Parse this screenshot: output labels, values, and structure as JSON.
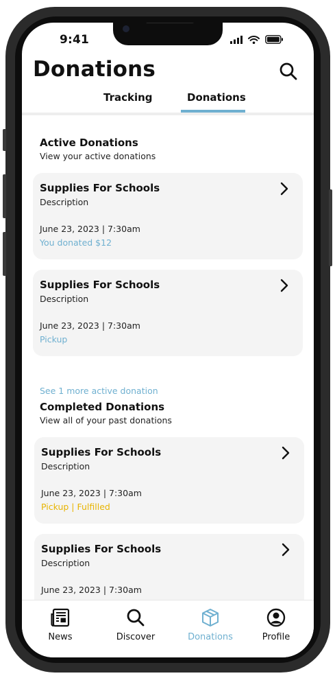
{
  "status_bar": {
    "time": "9:41"
  },
  "header": {
    "title": "Donations",
    "search_icon": "search-icon"
  },
  "tabs": [
    {
      "label": "Tracking",
      "active": false
    },
    {
      "label": "Donations",
      "active": true
    }
  ],
  "active_section": {
    "title": "Active Donations",
    "subtitle": "View your active donations",
    "cards": [
      {
        "title": "Supplies For Schools",
        "description": "Description",
        "date": "June 23, 2023 | 7:30am",
        "status": "You donated $12",
        "status_color": "#6fb0d0"
      },
      {
        "title": "Supplies For Schools",
        "description": "Description",
        "date": "June 23, 2023 | 7:30am",
        "status": "Pickup",
        "status_color": "#6fb0d0"
      }
    ],
    "see_more": "See 1 more active donation"
  },
  "completed_section": {
    "title": "Completed Donations",
    "subtitle": "View all of your past donations",
    "cards": [
      {
        "title": "Supplies For Schools",
        "description": "Description",
        "date": "June 23, 2023 | 7:30am",
        "status": "Pickup | Fulfilled",
        "status_color": "#e8b400"
      },
      {
        "title": "Supplies For Schools",
        "description": "Description",
        "date": "June 23, 2023 | 7:30am",
        "status": "",
        "status_color": "#e8b400"
      }
    ]
  },
  "bottom_nav": [
    {
      "label": "News",
      "icon": "newspaper-icon",
      "active": false
    },
    {
      "label": "Discover",
      "icon": "search-icon",
      "active": false
    },
    {
      "label": "Donations",
      "icon": "box-icon",
      "active": true
    },
    {
      "label": "Profile",
      "icon": "user-circle-icon",
      "active": false
    }
  ],
  "colors": {
    "accent": "#6fb0d0",
    "fulfilled": "#e8b400",
    "card_bg": "#f4f4f4"
  }
}
